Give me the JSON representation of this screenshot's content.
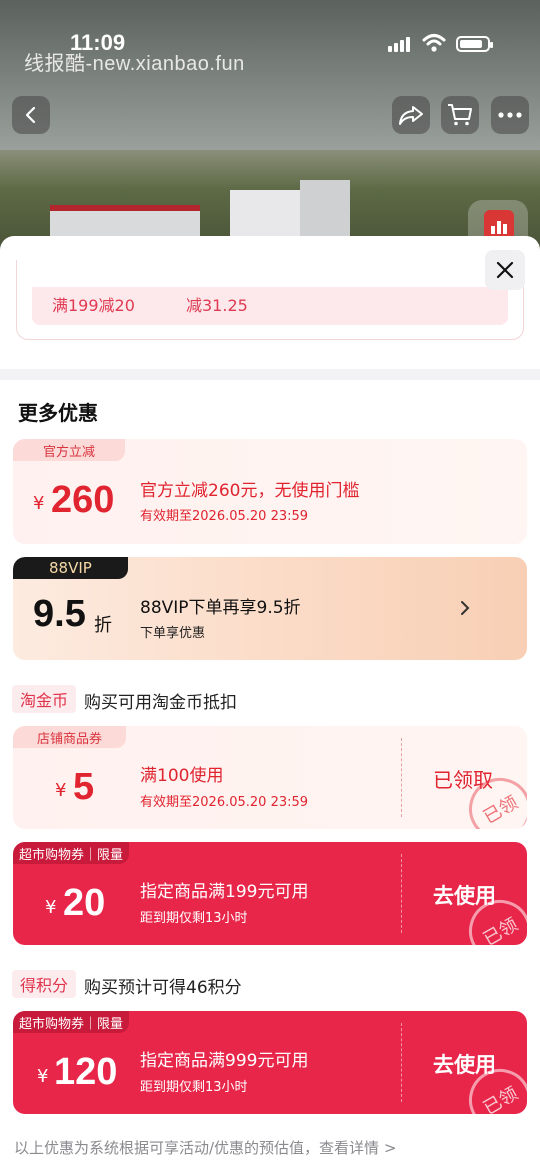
{
  "status_bar": {
    "time": "11:09",
    "battery_fraction": 0.85
  },
  "watermark": "线报酷-new.xianbao.fun",
  "nav": {
    "back_icon": "chevron-left-icon",
    "share_icon": "share-icon",
    "cart_icon": "cart-icon",
    "more_icon": "more-icon",
    "chart_icon": "chart-icon"
  },
  "previous_card": {
    "left_text": "满199减20",
    "right_text": "减31.25"
  },
  "section_title": "更多优惠",
  "offers": {
    "official": {
      "tag": "官方立减",
      "yen": "¥",
      "amount": "260",
      "title": "官方立减260元，无使用门槛",
      "validity": "有效期至2026.05.20 23:59"
    },
    "vip": {
      "tag": "88VIP",
      "discount": "9.5",
      "unit": "折",
      "title": "88VIP下单再享9.5折",
      "subtitle": "下单享优惠"
    },
    "taojinbi": {
      "label": "淘金币",
      "text": "购买可用淘金币抵扣"
    },
    "shop_coupon": {
      "tag": "店铺商品券",
      "yen": "¥",
      "amount": "5",
      "title": "满100使用",
      "validity": "有效期至2026.05.20 23:59",
      "action": "已领取",
      "stamp": "已领"
    },
    "supermarket1": {
      "tag": "超市购物券｜限量",
      "yen": "¥",
      "amount": "20",
      "title": "指定商品满199元可用",
      "subtitle": "距到期仅剩13小时",
      "action": "去使用",
      "stamp": "已领"
    },
    "points": {
      "label": "得积分",
      "text": "购买预计可得46积分"
    },
    "supermarket2": {
      "tag": "超市购物券｜限量",
      "yen": "¥",
      "amount": "120",
      "title": "指定商品满999元可用",
      "subtitle": "距到期仅剩13小时",
      "action": "去使用",
      "stamp": "已领"
    }
  },
  "footer": "以上优惠为系统根据可享活动/优惠的预估值，查看详情 >",
  "colors": {
    "accent_red": "#e02430",
    "coupon_red": "#e8264a",
    "vip_bg": "#f8d3bb"
  }
}
